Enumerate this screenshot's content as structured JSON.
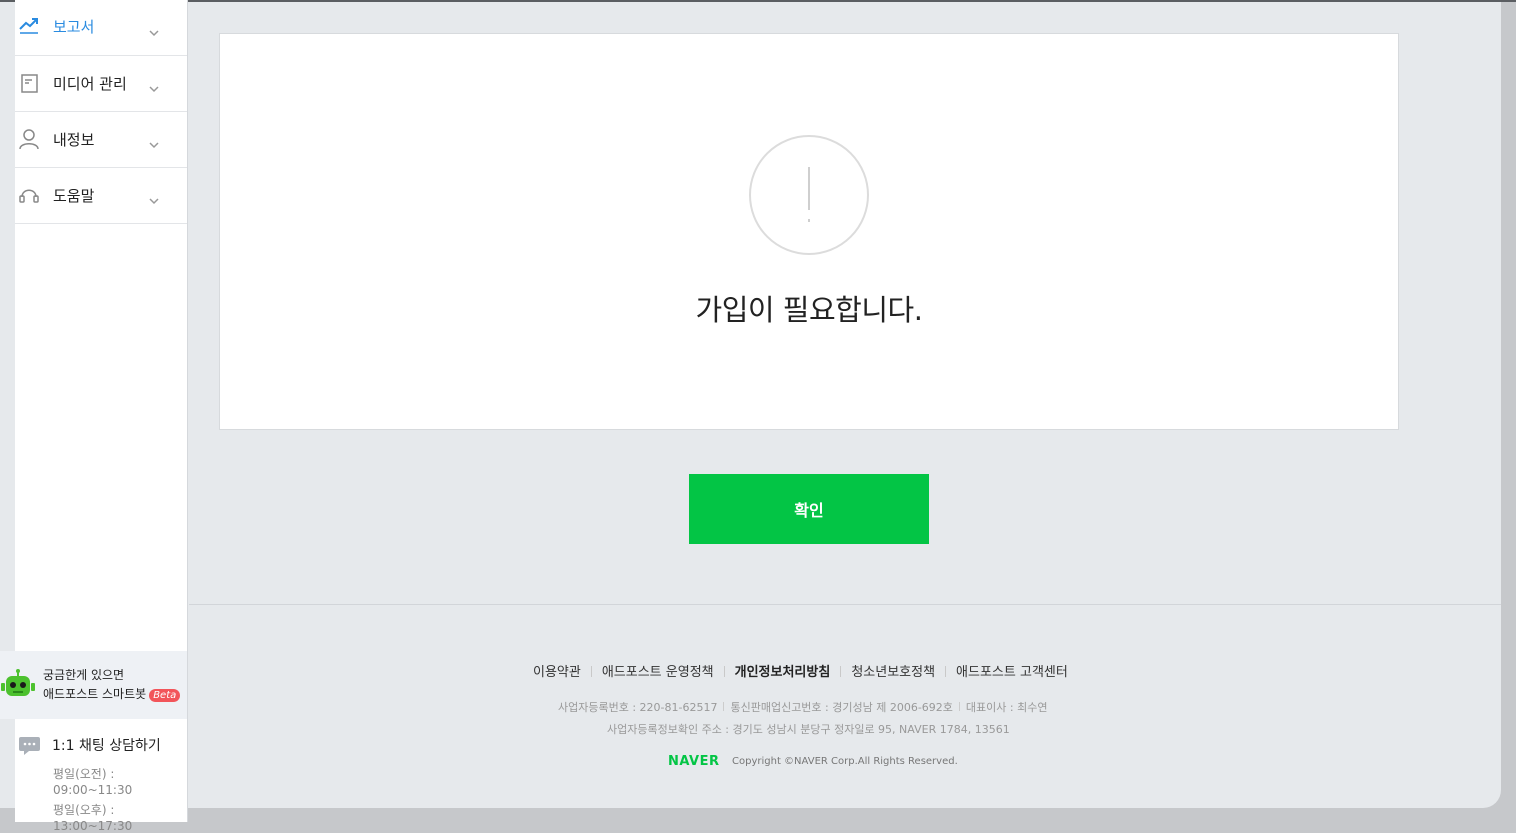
{
  "sidebar": {
    "items": [
      {
        "label": "보고서",
        "icon": "chart-line-icon",
        "active": true
      },
      {
        "label": "미디어 관리",
        "icon": "document-icon",
        "active": false
      },
      {
        "label": "내정보",
        "icon": "user-icon",
        "active": false
      },
      {
        "label": "도움말",
        "icon": "headset-icon",
        "active": false
      }
    ],
    "bot": {
      "line1": "궁금한게 있으면",
      "line2": "애드포스트 스마트봇",
      "badge": "Beta"
    },
    "chat": {
      "title": "1:1 채팅 상담하기",
      "hours": [
        "평일(오전) :",
        "09:00~11:30",
        "평일(오후) :",
        "13:00~17:30"
      ]
    }
  },
  "main": {
    "message": "가입이 필요합니다.",
    "confirm_label": "확인"
  },
  "footer": {
    "links": [
      "이용약관",
      "애드포스트 운영정책",
      "개인정보처리방침",
      "청소년보호정책",
      "애드포스트 고객센터"
    ],
    "biz_reg": "사업자등록번호 : 220-81-62517",
    "telecom": "통신판매업신고번호 : 경기성남 제 2006-692호",
    "ceo": "대표이사 : 최수연",
    "address": "사업자등록정보확인 주소 : 경기도 성남시 분당구 정자일로 95, NAVER 1784, 13561",
    "brand": "NAVER",
    "copyright": "Copyright ©NAVER Corp.All Rights Reserved."
  },
  "colors": {
    "accent": "#2a8be0",
    "confirm": "#03c545",
    "badge": "#f2555a"
  }
}
